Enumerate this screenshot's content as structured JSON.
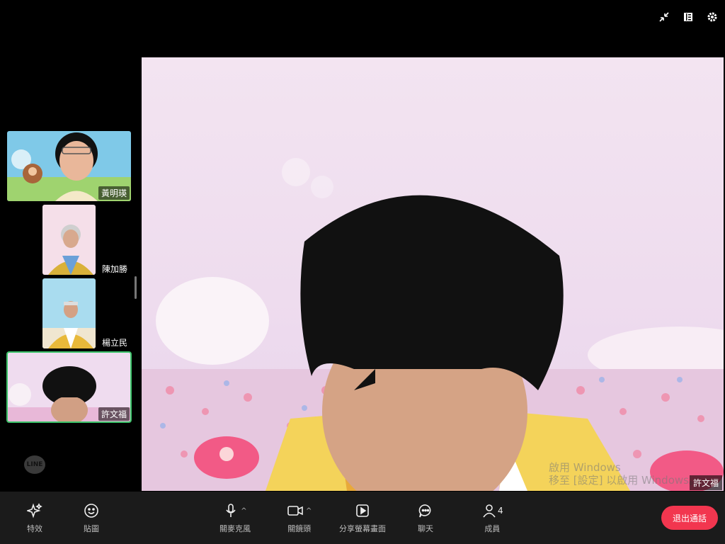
{
  "top_icons": [
    "collapse-icon",
    "layout-icon",
    "settings-icon"
  ],
  "participants": [
    {
      "name": "黃明瑛"
    },
    {
      "name": "陳加勝"
    },
    {
      "name": "楊立民"
    },
    {
      "name": "許文福"
    }
  ],
  "main_video": {
    "name": "許文福",
    "watermark_line1": "啟用 Windows",
    "watermark_line2": "移至 [設定] 以啟用 Windows。"
  },
  "logo": "LINE",
  "toolbar": {
    "effects": "特效",
    "stickers": "貼圖",
    "mic": "關麥克風",
    "camera": "關鏡頭",
    "share": "分享螢幕畫面",
    "chat": "聊天",
    "members": "成員",
    "member_count": "4",
    "end_call": "退出通話"
  },
  "colors": {
    "accent_green": "#3cc46a",
    "end_call_red": "#f2364f"
  }
}
